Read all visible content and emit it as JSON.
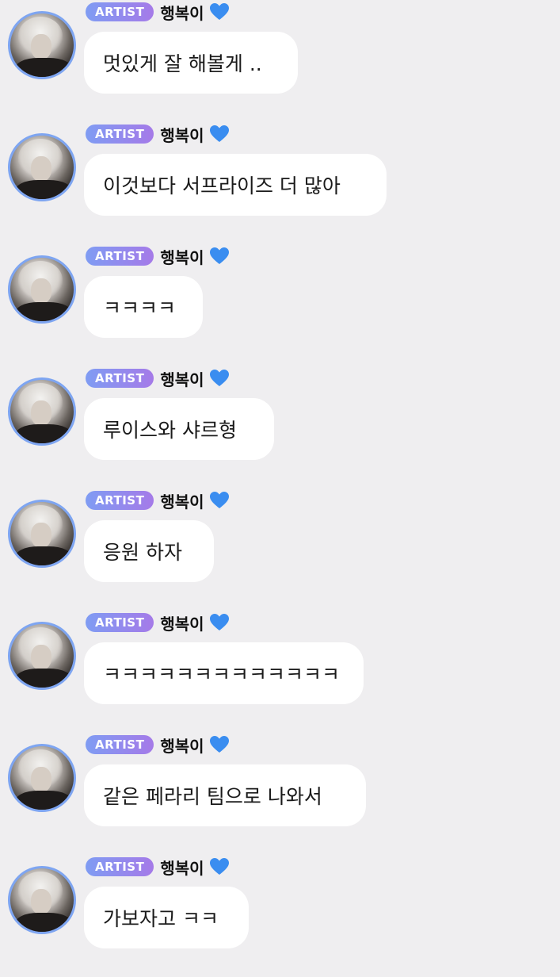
{
  "sender": {
    "badge": "ARTIST",
    "name": "행복이"
  },
  "colors": {
    "badge_start": "#7f9cf3",
    "badge_end": "#a57ae8",
    "heart": "#3a8df0",
    "avatar_ring": "#7ea5f1",
    "background": "#efeef0"
  },
  "messages": [
    {
      "text": "멋있게 잘 해볼게 .."
    },
    {
      "text": "이것보다 서프라이즈 더 많아"
    },
    {
      "text": "ㅋㅋㅋㅋ"
    },
    {
      "text": "루이스와 샤르형"
    },
    {
      "text": "응원 하자"
    },
    {
      "text": "ㅋㅋㅋㅋㅋㅋㅋㅋㅋㅋㅋㅋㅋ"
    },
    {
      "text": "같은 페라리 팀으로 나와서"
    },
    {
      "text": "가보자고 ㅋㅋ"
    }
  ]
}
